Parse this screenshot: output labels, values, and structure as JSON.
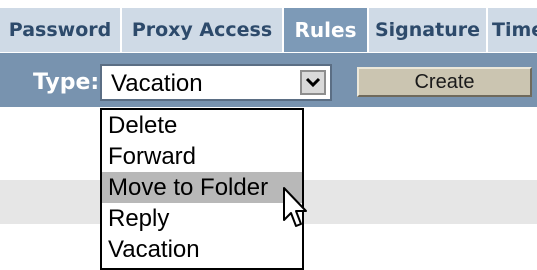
{
  "tabs": [
    {
      "label": "Password",
      "active": false
    },
    {
      "label": "Proxy Access",
      "active": false
    },
    {
      "label": "Rules",
      "active": true
    },
    {
      "label": "Signature",
      "active": false
    },
    {
      "label": "Time",
      "active": false
    }
  ],
  "rule_bar": {
    "type_label": "Type:",
    "type_select": {
      "selected": "Vacation",
      "arrow_icon": "chevron-down-icon"
    },
    "create_label": "Create"
  },
  "type_dropdown": {
    "options": [
      "Delete",
      "Forward",
      "Move to Folder",
      "Reply",
      "Vacation"
    ],
    "highlighted": "Move to Folder"
  },
  "colors": {
    "tab_bg": "#cfdae6",
    "tab_text": "#2d4a6b",
    "active_tab_bg": "#7d9ab7",
    "toolbar_bg": "#7893af",
    "create_button_bg": "#cbc5b1",
    "hover_bg": "#b8b8b8"
  },
  "cursor_icon": "arrow-pointer-icon"
}
